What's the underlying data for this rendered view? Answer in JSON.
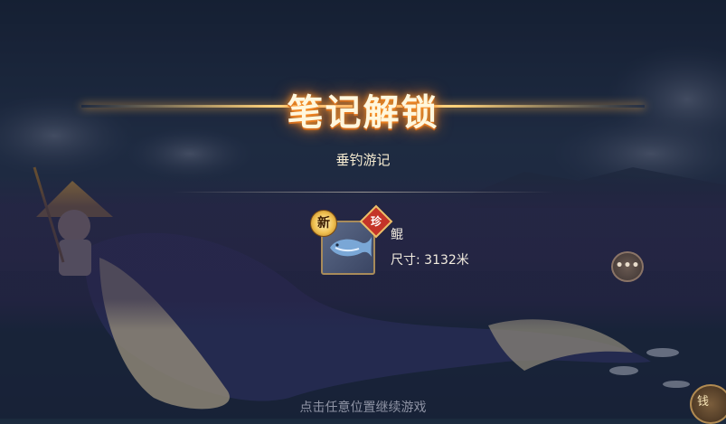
{
  "popup": {
    "title": "笔记解锁",
    "subtitle": "垂钓游记"
  },
  "item": {
    "badge_new": "新",
    "badge_rare": "珍",
    "name": "鲲",
    "size_text": "尺寸: 3132米",
    "icon": "whale-fish-icon"
  },
  "footer": {
    "hint": "点击任意位置继续游戏"
  },
  "side": {
    "chat_icon": "chat-bubble-icon",
    "corner_label": "钱"
  },
  "colors": {
    "title_glow": "#ff9a2a",
    "badge_rare_bg": "#c43428",
    "frame_border": "#a88b5a"
  }
}
